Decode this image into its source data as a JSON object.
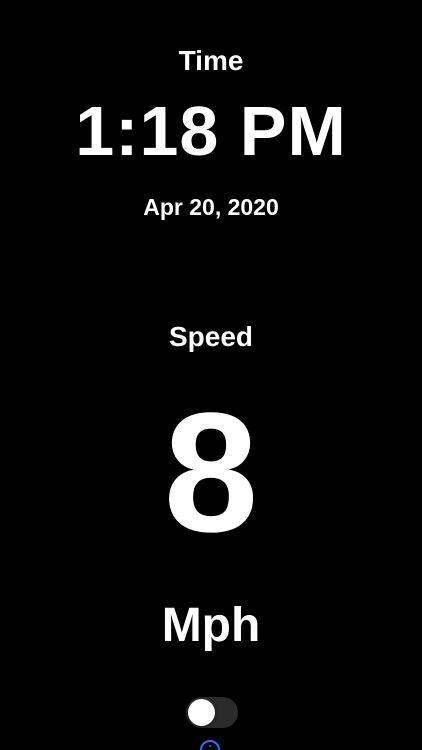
{
  "time": {
    "label": "Time",
    "value": "1:18 PM",
    "date": "Apr 20, 2020"
  },
  "speed": {
    "label": "Speed",
    "value": "8",
    "unit": "Mph"
  },
  "controls": {
    "toggle_state": "off",
    "toggle_icon": "toggle-switch",
    "info_icon": "info-icon",
    "accent_color": "#2f6fff"
  },
  "colors": {
    "background": "#000000",
    "text": "#ffffff"
  }
}
